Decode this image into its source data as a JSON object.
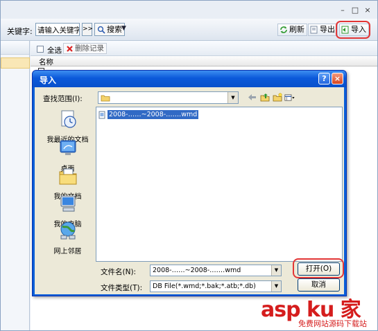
{
  "app": {
    "window_controls": [
      "–",
      "□",
      "×"
    ],
    "toolbar": {
      "keyword_label": "关键字:",
      "keyword_placeholder": "请输入关键字",
      "go_label": ">>",
      "search_label": "搜索",
      "refresh_label": "刷新",
      "export_label": "导出",
      "import_label": "导入"
    },
    "list": {
      "select_all_label": "全选",
      "delete_label": "删除记录",
      "column_name": "名称"
    }
  },
  "dialog": {
    "title": "导入",
    "help_label": "?",
    "close_label": "×",
    "look_in_label": "查找范围(I):",
    "look_in_value": "",
    "places": [
      {
        "label": "我最近的文档",
        "icon": "recent-documents-icon"
      },
      {
        "label": "桌面",
        "icon": "desktop-icon"
      },
      {
        "label": "我的文档",
        "icon": "my-documents-icon"
      },
      {
        "label": "我的电脑",
        "icon": "my-computer-icon"
      },
      {
        "label": "网上邻居",
        "icon": "network-places-icon"
      }
    ],
    "files": [
      {
        "name": "2008-……~2008-…….wmd",
        "selected": true
      }
    ],
    "file_name_label": "文件名(N):",
    "file_name_value": "2008-……~2008-…….wmd",
    "file_type_label": "文件类型(T):",
    "file_type_value": "DB File(*.wmd;*.bak;*.atb;*.db)",
    "open_label": "打开(O)",
    "cancel_label": "取消"
  },
  "watermark": {
    "main": "asp ku 家",
    "sub": "免费网站源码下载站"
  },
  "colors": {
    "dialog_title_blue": "#0b59da",
    "selection_blue": "#316ac5",
    "highlight_red": "#e23636",
    "watermark_red": "#d51d1d"
  }
}
